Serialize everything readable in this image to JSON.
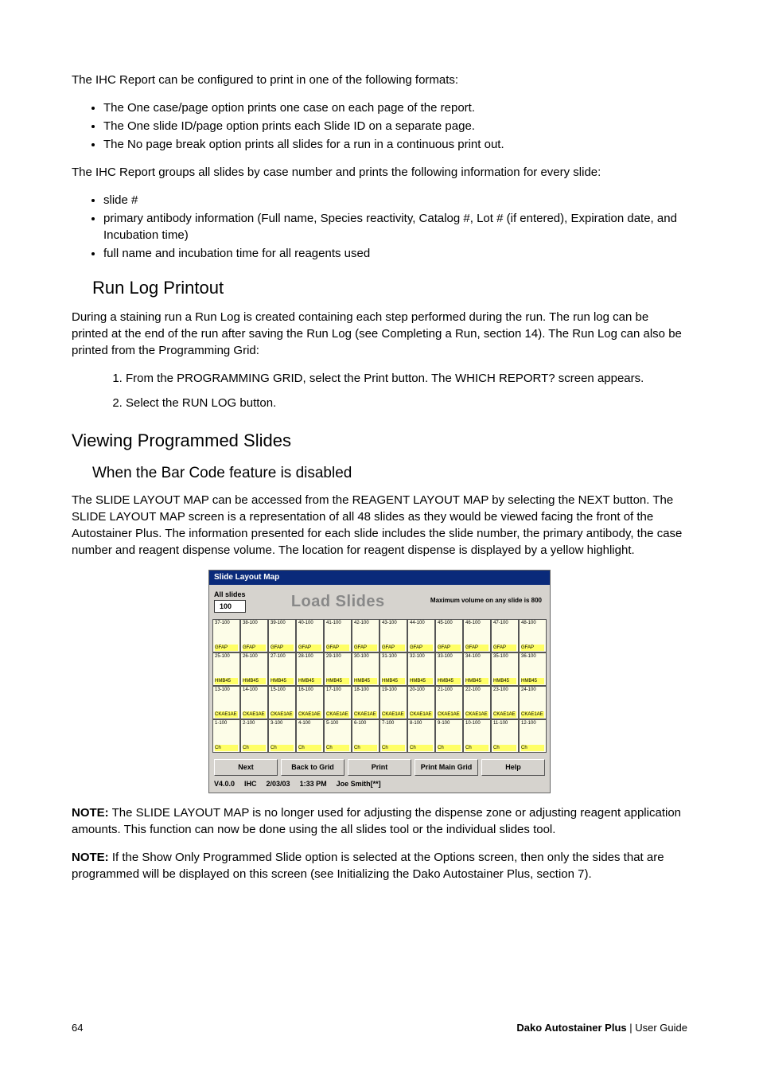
{
  "p_intro": "The IHC Report can be configured to print in one of the following formats:",
  "list1": {
    "i1": "The One case/page option prints one case on each page of the report.",
    "i2": "The One slide ID/page option prints each Slide ID on a separate page.",
    "i3": "The No page break option prints all slides for a run in a continuous print out."
  },
  "p_group": "The IHC Report groups all slides by case number and prints the following information for every slide:",
  "list2": {
    "i1": "slide #",
    "i2": "primary antibody information (Full name, Species reactivity, Catalog #, Lot # (if entered), Expiration date, and Incubation time)",
    "i3": "full name and incubation time for all reagents used"
  },
  "h2_runlog": "Run Log Printout",
  "p_runlog": "During a staining run a Run Log is created containing each step performed during the run. The run log can be printed at the end of the run after saving the Run Log (see Completing a Run, section 14). The Run Log can also be printed from the Programming Grid:",
  "ol1": {
    "i1": "From the PROGRAMMING GRID, select the Print button. The WHICH REPORT? screen appears.",
    "i2": "Select the RUN LOG button."
  },
  "h2_viewing": "Viewing Programmed Slides",
  "h3_barcode": "When the Bar Code feature is disabled",
  "p_layout": "The SLIDE LAYOUT MAP can be accessed from the REAGENT LAYOUT MAP by selecting the NEXT button. The SLIDE LAYOUT MAP screen is a representation of all 48 slides as they would be viewed facing the front of the Autostainer Plus. The information presented for each slide includes the slide number, the primary antibody, the case number and reagent dispense volume. The location for reagent dispense is displayed by a yellow highlight.",
  "note1_label": "NOTE:",
  "note1_body": "  The SLIDE LAYOUT MAP is no longer used for adjusting the dispense zone or adjusting reagent application amounts. This function can now be done using the all slides tool or the individual slides tool.",
  "note2_label": "NOTE:",
  "note2_body": "  If the Show Only Programmed Slide option is selected at the Options screen, then only the sides that are programmed will be displayed on this screen (see Initializing the Dako Autostainer Plus, section 7).",
  "map": {
    "title": "Slide Layout Map",
    "all_slides_label": "All slides",
    "all_slides_value": "100",
    "load_slides": "Load Slides",
    "max_vol": "Maximum volume on any slide is 800",
    "buttons": {
      "next": "Next",
      "back": "Back to Grid",
      "print": "Print",
      "main": "Print Main Grid",
      "help": "Help"
    },
    "status": {
      "ver": "V4.0.0",
      "mode": "IHC",
      "date": "2/03/03",
      "time": "1:33 PM",
      "user": "Joe Smith[**]"
    },
    "rows": [
      {
        "top": [
          "37-100",
          "38-100",
          "39-100",
          "40-100",
          "41-100",
          "42-100",
          "43-100",
          "44-100",
          "45-100",
          "46-100",
          "47-100",
          "48-100"
        ],
        "reagent": [
          "GFAP",
          "GFAP",
          "GFAP",
          "GFAP",
          "GFAP",
          "GFAP",
          "GFAP",
          "GFAP",
          "GFAP",
          "GFAP",
          "GFAP",
          "GFAP"
        ]
      },
      {
        "top": [
          "25-100",
          "26-100",
          "27-100",
          "28-100",
          "29-100",
          "30-100",
          "31-100",
          "32-100",
          "33-100",
          "34-100",
          "35-100",
          "36-100"
        ],
        "reagent": [
          "HMB45",
          "HMB45",
          "HMB45",
          "HMB45",
          "HMB45",
          "HMB45",
          "HMB45",
          "HMB45",
          "HMB45",
          "HMB45",
          "HMB45",
          "HMB45"
        ]
      },
      {
        "top": [
          "13-100",
          "14-100",
          "15-100",
          "16-100",
          "17-100",
          "18-100",
          "19-100",
          "20-100",
          "21-100",
          "22-100",
          "23-100",
          "24-100"
        ],
        "reagent": [
          "CKAE1AE",
          "CKAE1AE",
          "CKAE1AE",
          "CKAE1AE",
          "CKAE1AE",
          "CKAE1AE",
          "CKAE1AE",
          "CKAE1AE",
          "CKAE1AE",
          "CKAE1AE",
          "CKAE1AE",
          "CKAE1AE"
        ]
      },
      {
        "top": [
          "1-100",
          "2-100",
          "3-100",
          "4-100",
          "5-100",
          "6-100",
          "7-100",
          "8-100",
          "9-100",
          "10-100",
          "11-100",
          "12-100"
        ],
        "reagent": [
          "Ch",
          "Ch",
          "Ch",
          "Ch",
          "Ch",
          "Ch",
          "Ch",
          "Ch",
          "Ch",
          "Ch",
          "Ch",
          "Ch"
        ]
      }
    ]
  },
  "footer": {
    "page": "64",
    "product_bold": "Dako Autostainer Plus",
    "product_rest": " | User Guide"
  }
}
